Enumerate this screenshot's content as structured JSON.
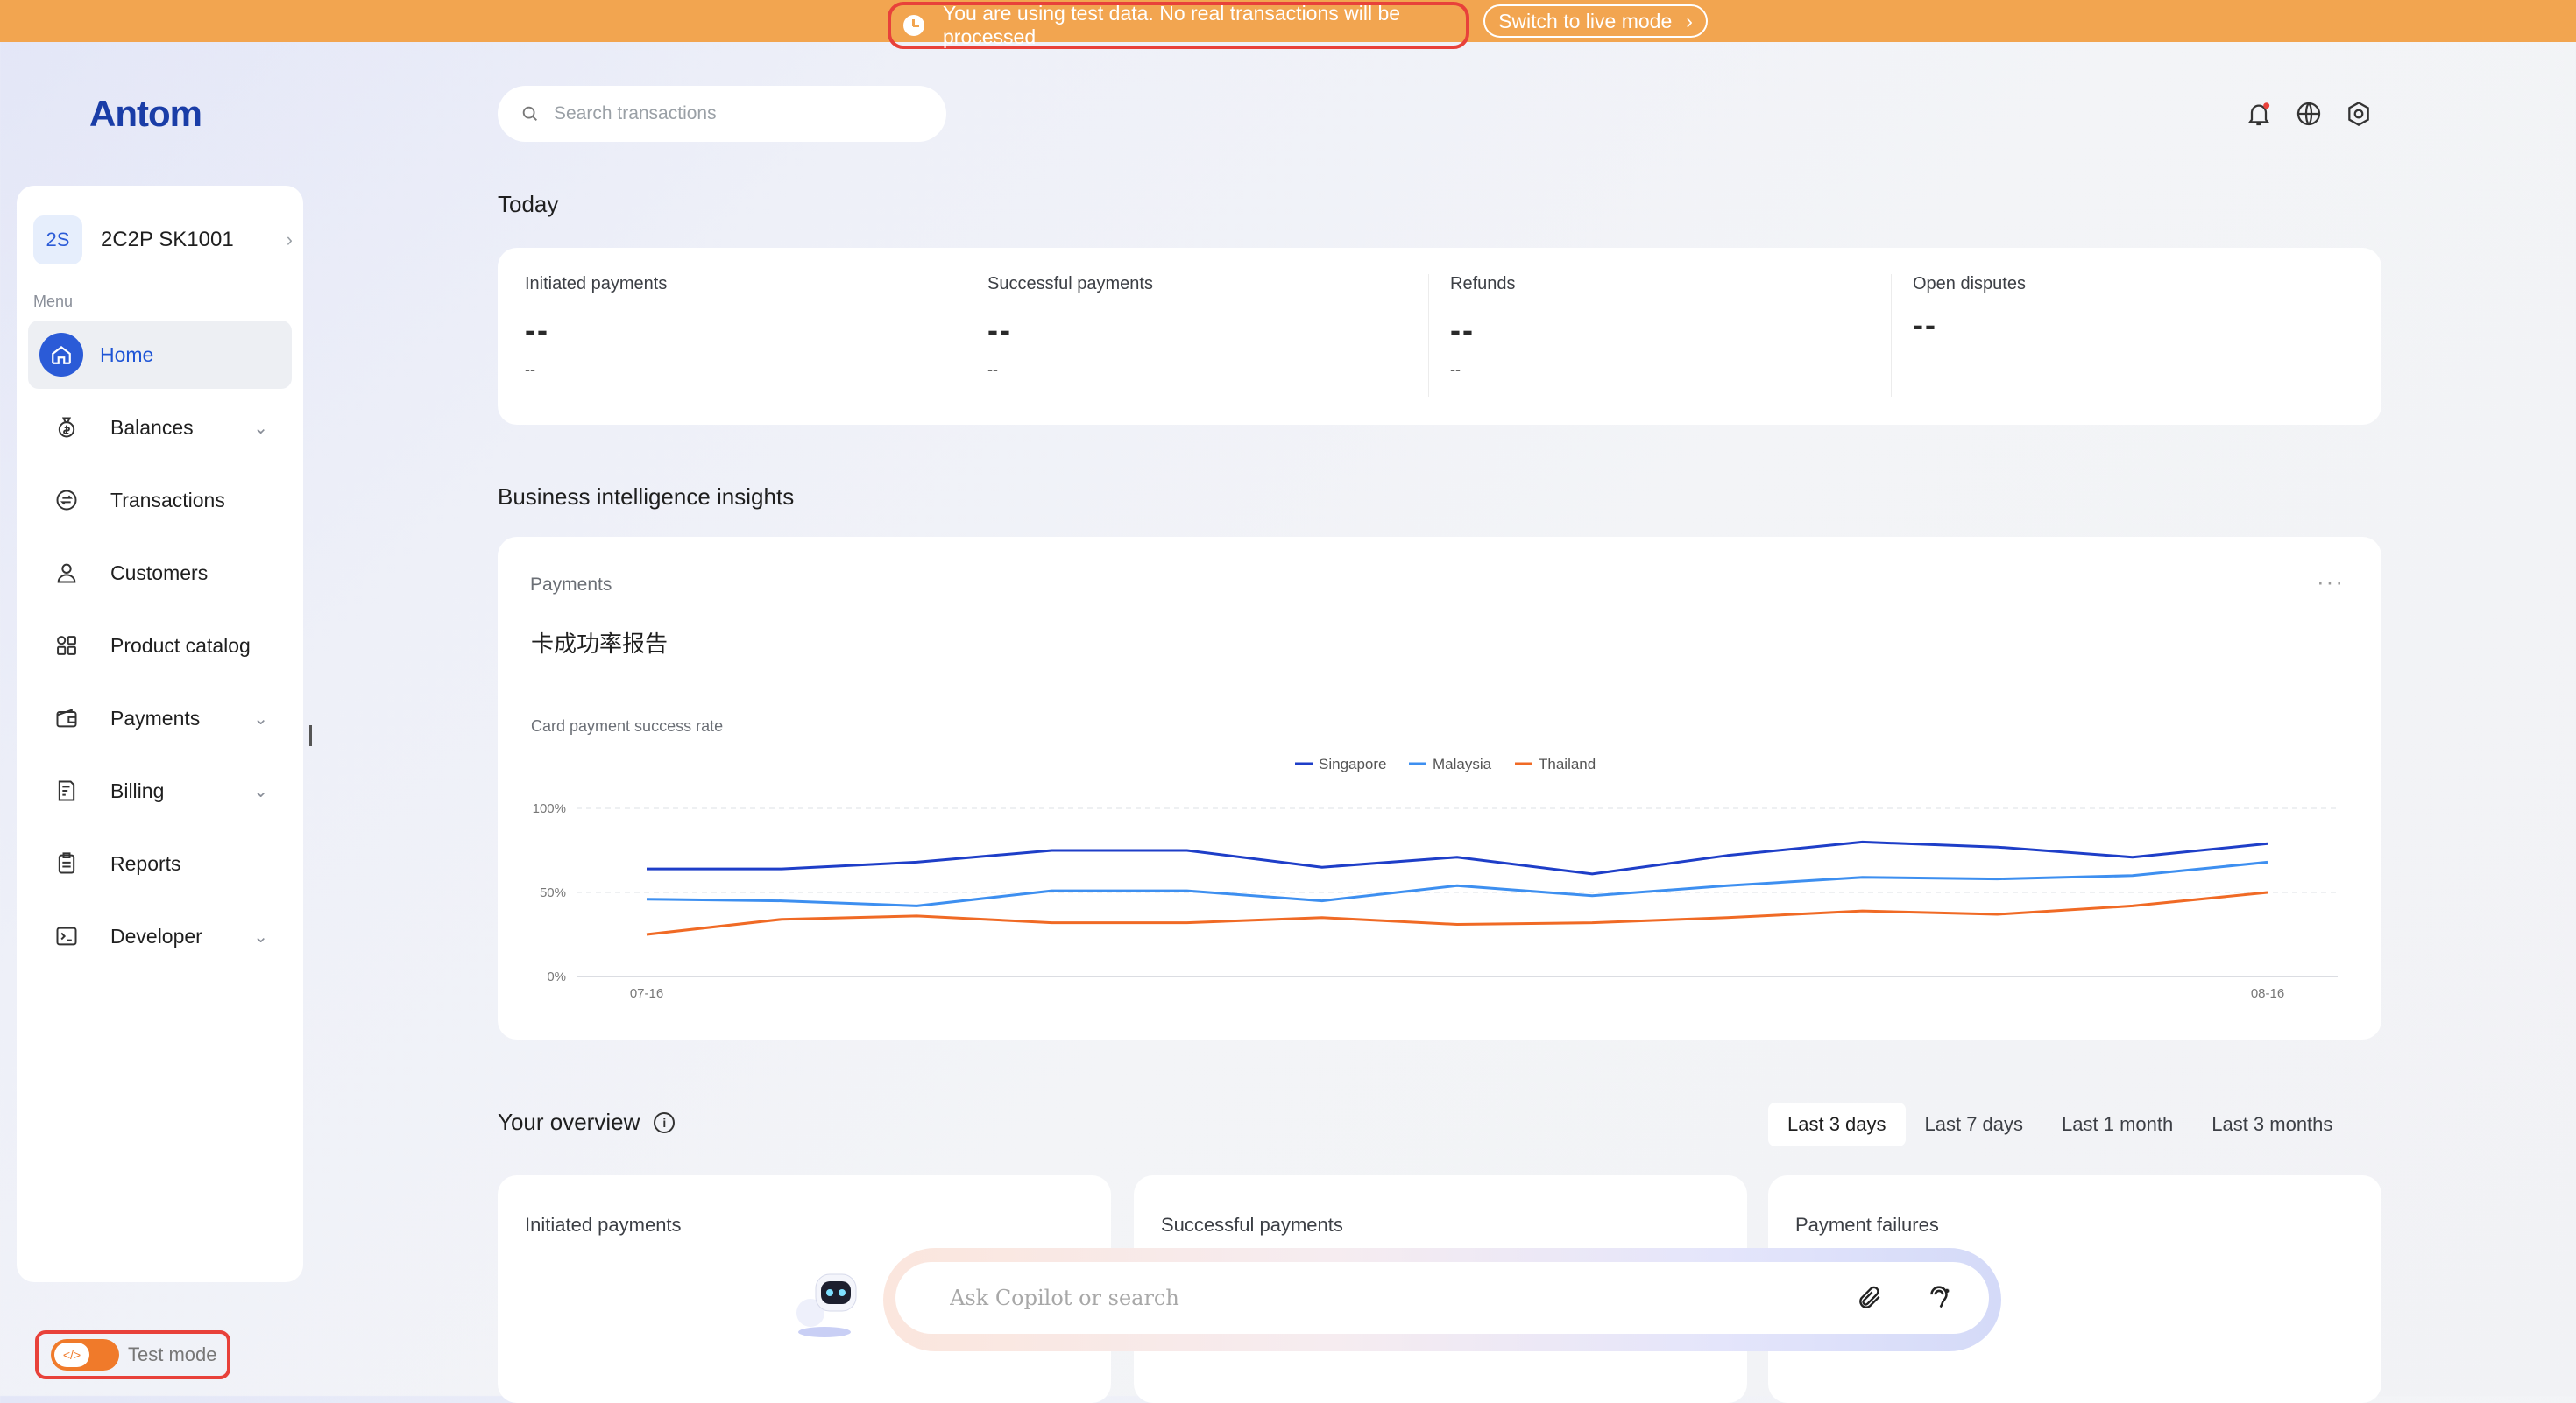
{
  "banner": {
    "message": "You are using test data. No real transactions will be processed",
    "button_label": "Switch to live mode",
    "color": "#f2a550"
  },
  "logo": {
    "text": "Antom"
  },
  "sidebar": {
    "account": {
      "initials": "2S",
      "name": "2C2P SK1001"
    },
    "menu_label": "Menu",
    "items": [
      {
        "label": "Home",
        "icon": "home-icon",
        "active": true
      },
      {
        "label": "Balances",
        "icon": "money-bag-icon",
        "expandable": true
      },
      {
        "label": "Transactions",
        "icon": "exchange-icon"
      },
      {
        "label": "Customers",
        "icon": "user-icon"
      },
      {
        "label": "Product catalog",
        "icon": "grid-icon"
      },
      {
        "label": "Payments",
        "icon": "wallet-icon",
        "expandable": true
      },
      {
        "label": "Billing",
        "icon": "bill-icon",
        "expandable": true
      },
      {
        "label": "Reports",
        "icon": "report-icon"
      },
      {
        "label": "Developer",
        "icon": "terminal-icon",
        "expandable": true
      }
    ],
    "test_mode": {
      "label": "Test mode",
      "on": true
    }
  },
  "search": {
    "placeholder": "Search transactions"
  },
  "today": {
    "title": "Today",
    "stats": [
      {
        "title": "Initiated payments",
        "value": "--",
        "sub": "--"
      },
      {
        "title": "Successful payments",
        "value": "--",
        "sub": "--"
      },
      {
        "title": "Refunds",
        "value": "--",
        "sub": "--"
      },
      {
        "title": "Open disputes",
        "value": "--"
      }
    ]
  },
  "insights": {
    "title": "Business intelligence insights",
    "card_label": "Payments",
    "report_title": "卡成功率报告"
  },
  "chart_data": {
    "type": "line",
    "title": "Card payment success rate",
    "x": [
      "07-16",
      "",
      "",
      "",
      "",
      "",
      "",
      "",
      "",
      "",
      "",
      "",
      "",
      "",
      "",
      "08-16"
    ],
    "x_tick_labels": [
      "07-16",
      "08-16"
    ],
    "y_tick_labels": [
      "100%",
      "50%",
      "0%"
    ],
    "ylim": [
      0,
      100
    ],
    "grid": true,
    "legend": "top-center",
    "series": [
      {
        "name": "Singapore",
        "color": "#1e3ec8",
        "values": [
          64,
          64,
          68,
          75,
          75,
          65,
          71,
          61,
          72,
          80,
          77,
          71,
          79
        ]
      },
      {
        "name": "Malaysia",
        "color": "#3d8ff0",
        "values": [
          46,
          45,
          42,
          51,
          51,
          45,
          54,
          48,
          54,
          59,
          58,
          60,
          68
        ]
      },
      {
        "name": "Thailand",
        "color": "#f06a25",
        "values": [
          25,
          34,
          36,
          32,
          32,
          35,
          31,
          32,
          35,
          39,
          37,
          42,
          50
        ]
      }
    ]
  },
  "overview": {
    "title": "Your overview",
    "ranges": [
      "Last 3 days",
      "Last 7 days",
      "Last 1 month",
      "Last 3 months"
    ],
    "selected_range": "Last 3 days",
    "cards": [
      "Initiated payments",
      "Successful payments",
      "Payment failures"
    ]
  },
  "copilot": {
    "placeholder": "Ask Copilot or search"
  }
}
